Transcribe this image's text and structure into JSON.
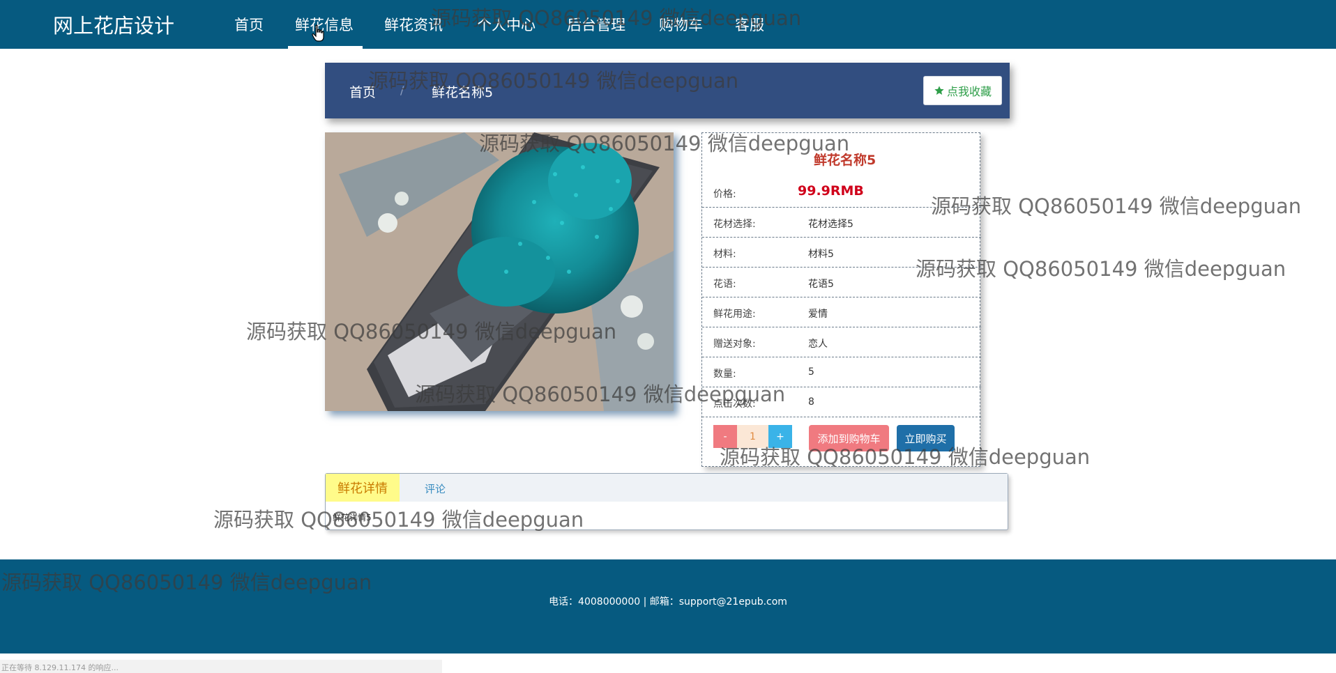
{
  "nav": {
    "brand": "网上花店设计",
    "items": [
      "首页",
      "鲜花信息",
      "鲜花资讯",
      "个人中心",
      "后台管理",
      "购物车",
      "客服"
    ],
    "active_index": 1
  },
  "breadcrumb": {
    "home": "首页",
    "separator": "/",
    "current": "鲜花名称5",
    "favorite_label": "点我收藏"
  },
  "product": {
    "title": "鲜花名称5",
    "price_label": "价格:",
    "price": "99.9RMB",
    "fields": [
      {
        "label": "花材选择:",
        "value": "花材选择5"
      },
      {
        "label": "材料:",
        "value": "材料5"
      },
      {
        "label": "花语:",
        "value": "花语5"
      },
      {
        "label": "鲜花用途:",
        "value": "爱情"
      },
      {
        "label": "赠送对象:",
        "value": "恋人"
      },
      {
        "label": "数量:",
        "value": "5"
      },
      {
        "label": "点击次数:",
        "value": "8"
      }
    ],
    "qty_minus": "-",
    "qty_value": "1",
    "qty_plus": "+",
    "add_to_cart": "添加到购物车",
    "buy_now": "立即购买"
  },
  "tabs": {
    "active": "鲜花详情",
    "other": "评论",
    "content": "鲜花详情5"
  },
  "footer": {
    "text": "电话：4008000000 | 邮箱：support@21epub.com"
  },
  "status": {
    "text": "正在等待 8.129.11.174 的响应..."
  },
  "watermark": "源码获取 QQ86050149 微信deepguan",
  "colors": {
    "nav_bg": "#065a80",
    "crumb_bg": "#324e80",
    "price": "#d0021b",
    "title": "#c0392b",
    "cart_btn": "#f07a80",
    "buy_btn": "#1f6fa8"
  }
}
